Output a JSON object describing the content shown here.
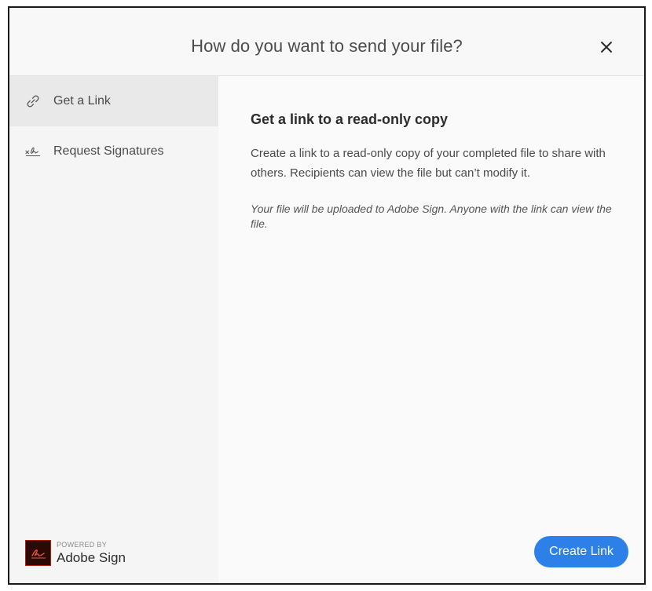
{
  "dialog": {
    "title": "How do you want to send your file?",
    "close_icon": "close-icon"
  },
  "sidebar": {
    "items": [
      {
        "label": "Get a Link",
        "icon": "link-icon",
        "selected": true
      },
      {
        "label": "Request Signatures",
        "icon": "signature-icon",
        "selected": false
      }
    ]
  },
  "main": {
    "heading": "Get a link to a read-only copy",
    "description": "Create a link to a read-only copy of your completed file to share with others. Recipients can view the file but can’t modify it.",
    "note": "Your file will be uploaded to Adobe Sign. Anyone with the link can view the file.",
    "primary_button": "Create Link"
  },
  "branding": {
    "powered_by": "POWERED BY",
    "product": "Adobe Sign",
    "logo_icon": "adobe-sign-logo"
  },
  "colors": {
    "accent": "#2d80e8",
    "selected_bg": "#e9e9e9",
    "logo_bg": "#2b0a06"
  }
}
